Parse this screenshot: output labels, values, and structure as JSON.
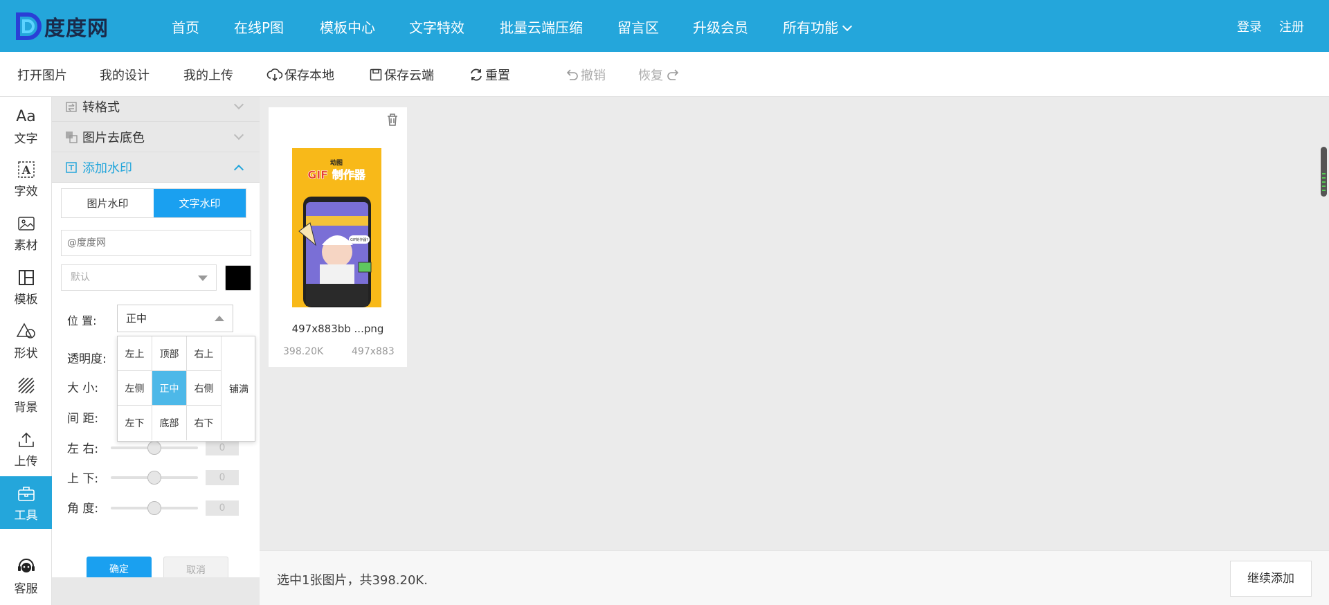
{
  "brand": {
    "name": "度度网"
  },
  "nav": {
    "items": [
      "首页",
      "在线P图",
      "模板中心",
      "文字特效",
      "批量云端压缩",
      "留言区",
      "升级会员",
      "所有功能"
    ],
    "login": "登录",
    "register": "注册"
  },
  "toolbar": {
    "open": "打开图片",
    "my_design": "我的设计",
    "my_upload": "我的上传",
    "save_local": "保存本地",
    "save_cloud": "保存云端",
    "reset": "重置",
    "undo": "撤销",
    "redo": "恢复"
  },
  "rail": {
    "items": [
      "文字",
      "字效",
      "素材",
      "模板",
      "形状",
      "背景",
      "上传",
      "工具",
      "客服"
    ],
    "active": "工具"
  },
  "panel": {
    "accordion": [
      "转格式",
      "图片去底色",
      "添加水印"
    ],
    "tabs": [
      "图片水印",
      "文字水印"
    ],
    "active_tab": "文字水印",
    "text_value": "@度度网",
    "font_value": "默认",
    "color": "#000000",
    "position_label": "位  置:",
    "position_value": "正中",
    "labels": {
      "opacity": "透明度:",
      "size": "大  小:",
      "spacing": "间  距:",
      "lr": "左  右:",
      "ud": "上  下:",
      "angle": "角  度:"
    },
    "slider_values": {
      "lr": "0",
      "ud": "0",
      "angle": "0"
    },
    "ok": "确定",
    "cancel": "取消"
  },
  "position_grid": {
    "cells": [
      "左上",
      "顶部",
      "右上",
      "左侧",
      "正中",
      "右侧",
      "左下",
      "底部",
      "右下"
    ],
    "fill": "铺满",
    "selected": "正中"
  },
  "image_card": {
    "name": "497x883bb ...png",
    "size": "398.20K",
    "dimensions": "497x883",
    "thumb_text_top": "动图",
    "thumb_text_main": "GIF 制作器",
    "thumb_bubble": "GIF制作器?"
  },
  "status": {
    "text": "选中1张图片，共398.20K.",
    "continue": "继续添加"
  },
  "colors": {
    "primary": "#24a6db",
    "button_blue": "#1aa0f0",
    "cell_selected": "#4db8e8"
  }
}
